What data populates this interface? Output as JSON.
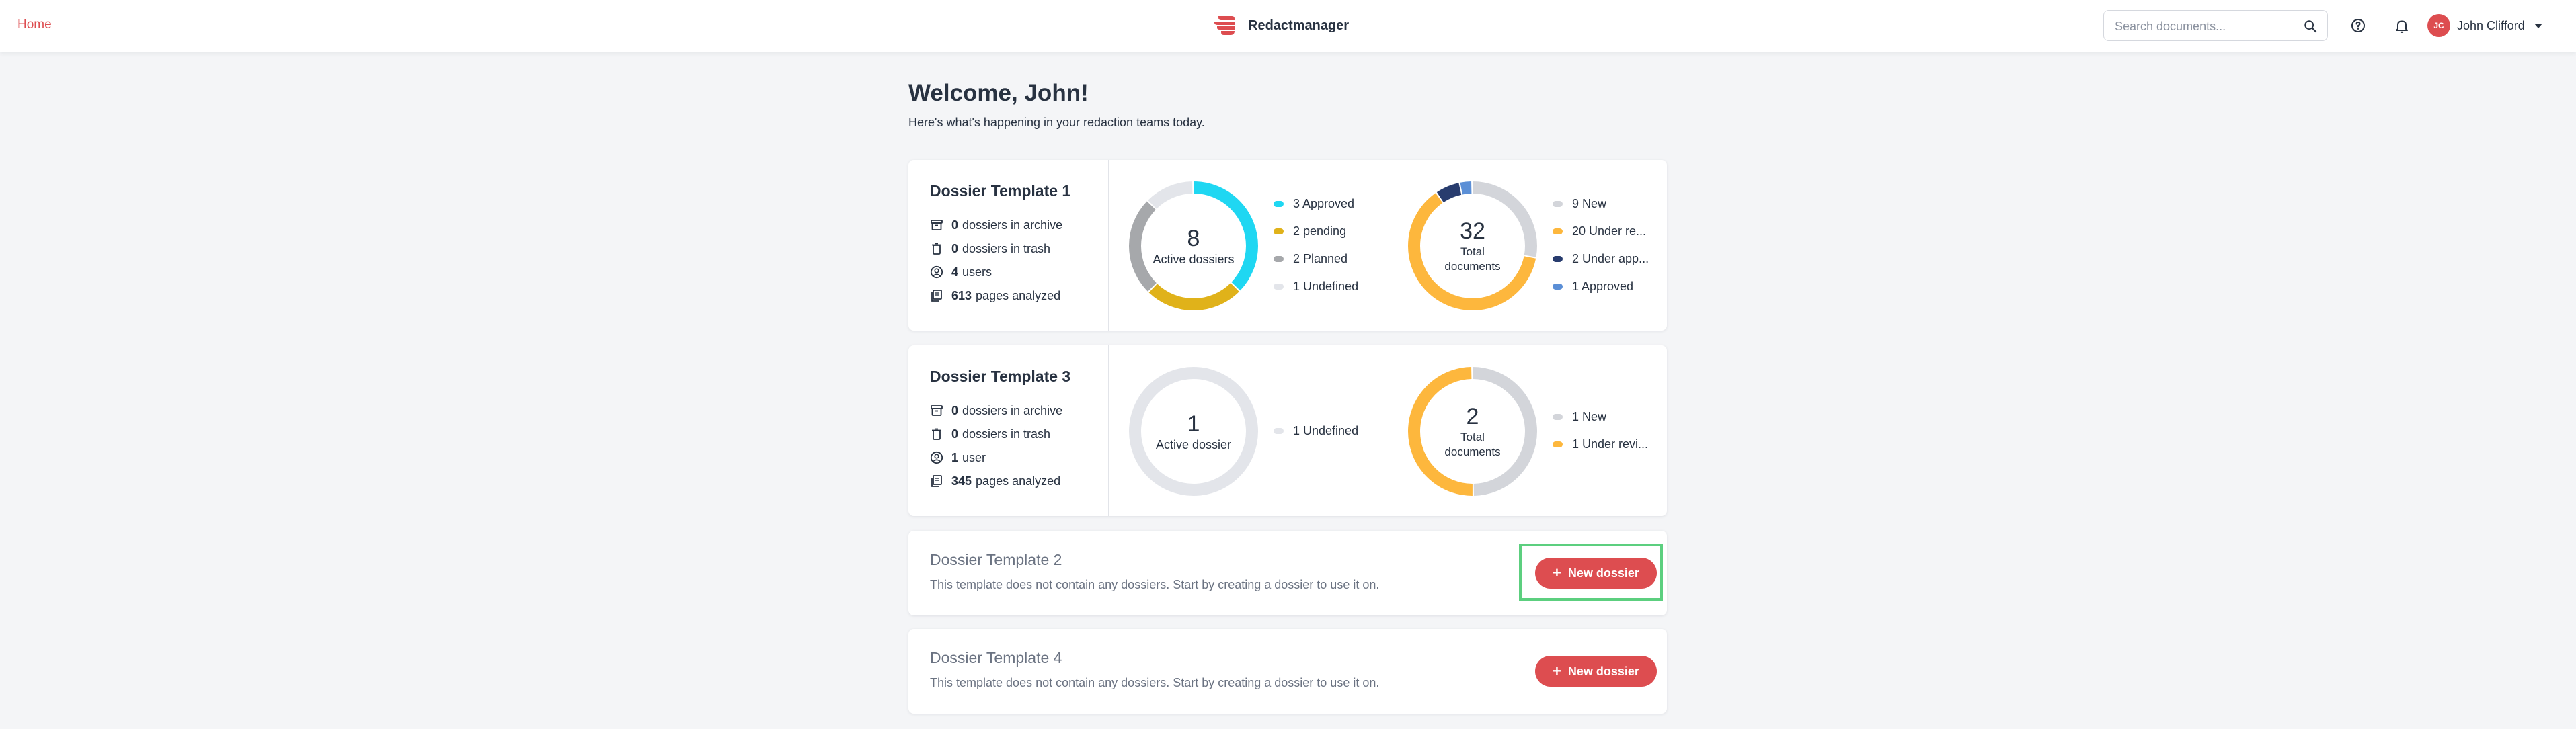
{
  "nav": {
    "home_label": "Home"
  },
  "brand": {
    "name": "Redactmanager"
  },
  "search": {
    "placeholder": "Search documents..."
  },
  "user": {
    "initials": "JC",
    "name": "John Clifford"
  },
  "welcome": {
    "title": "Welcome, John!",
    "subtitle": "Here's what's happening in your redaction teams today."
  },
  "templates": [
    {
      "title": "Dossier Template 1",
      "stats": [
        {
          "icon": "archive-icon",
          "value": "0",
          "label": "dossiers in archive"
        },
        {
          "icon": "trash-icon",
          "value": "0",
          "label": "dossiers in trash"
        },
        {
          "icon": "user-icon",
          "value": "4",
          "label": "users"
        },
        {
          "icon": "pages-icon",
          "value": "613",
          "label": "pages analyzed"
        }
      ],
      "dossiers_chart": {
        "total": "8",
        "label": "Active dossiers",
        "legend": [
          {
            "label": "3 Approved",
            "value": 3,
            "color": "#1fd7f2"
          },
          {
            "label": "2 pending",
            "value": 2,
            "color": "#e0b21a"
          },
          {
            "label": "2 Planned",
            "value": 2,
            "color": "#a6a8ab"
          },
          {
            "label": "1 Undefined",
            "value": 1,
            "color": "#e3e5ea"
          }
        ]
      },
      "documents_chart": {
        "total": "32",
        "label_lines": [
          "Total",
          "documents"
        ],
        "legend": [
          {
            "label": "9 New",
            "value": 9,
            "color": "#d3d5da"
          },
          {
            "label": "20 Under re...",
            "value": 20,
            "color": "#fdb73d"
          },
          {
            "label": "2 Under app...",
            "value": 2,
            "color": "#283c6e"
          },
          {
            "label": "1 Approved",
            "value": 1,
            "color": "#5b8fd6"
          }
        ]
      }
    },
    {
      "title": "Dossier Template 3",
      "stats": [
        {
          "icon": "archive-icon",
          "value": "0",
          "label": "dossiers in archive"
        },
        {
          "icon": "trash-icon",
          "value": "0",
          "label": "dossiers in trash"
        },
        {
          "icon": "user-icon",
          "value": "1",
          "label": "user"
        },
        {
          "icon": "pages-icon",
          "value": "345",
          "label": "pages analyzed"
        }
      ],
      "dossiers_chart": {
        "total": "1",
        "label": "Active dossier",
        "legend": [
          {
            "label": "1 Undefined",
            "value": 1,
            "color": "#e3e5ea"
          }
        ]
      },
      "documents_chart": {
        "total": "2",
        "label_lines": [
          "Total",
          "documents"
        ],
        "legend": [
          {
            "label": "1 New",
            "value": 1,
            "color": "#d3d5da"
          },
          {
            "label": "1 Under revi...",
            "value": 1,
            "color": "#fdb73d"
          }
        ]
      }
    }
  ],
  "empty_templates": [
    {
      "title": "Dossier Template 2",
      "description": "This template does not contain any dossiers. Start by creating a dossier to use it on.",
      "button_label": "New dossier"
    },
    {
      "title": "Dossier Template 4",
      "description": "This template does not contain any dossiers. Start by creating a dossier to use it on.",
      "button_label": "New dossier"
    }
  ],
  "button_icon": "+",
  "colors": {
    "accent": "#dd4d50",
    "highlight": "#5ccf7f"
  }
}
